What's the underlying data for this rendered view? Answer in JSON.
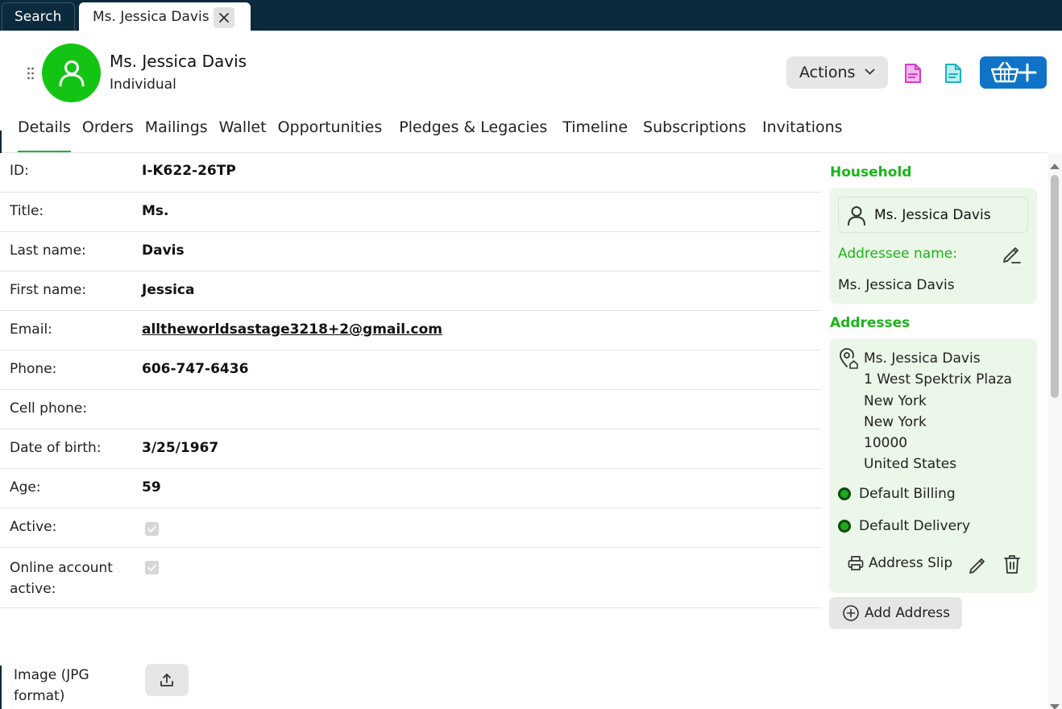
{
  "tabs": {
    "search_label": "Search",
    "active_label": "Ms. Jessica Davis"
  },
  "header": {
    "name": "Ms. Jessica Davis",
    "type": "Individual",
    "actions_label": "Actions"
  },
  "nav": {
    "items": [
      "Details",
      "Orders",
      "Mailings",
      "Wallet",
      "Opportunities",
      "Pledges & Legacies",
      "Timeline",
      "Subscriptions",
      "Invitations"
    ],
    "active": "Details"
  },
  "details": {
    "id_label": "ID:",
    "id_value": "I-K622-26TP",
    "title_label": "Title:",
    "title_value": "Ms.",
    "last_name_label": "Last name:",
    "last_name_value": "Davis",
    "first_name_label": "First name:",
    "first_name_value": "Jessica",
    "email_label": "Email:",
    "email_value": "alltheworldsastage3218+2@gmail.com",
    "phone_label": "Phone:",
    "phone_value": "606-747-6436",
    "cell_label": "Cell phone:",
    "cell_value": "",
    "dob_label": "Date of birth:",
    "dob_value": "3/25/1967",
    "age_label": "Age:",
    "age_value": "59",
    "active_label": "Active:",
    "active_checked": true,
    "online_label_1": "Online account",
    "online_label_2": "active:",
    "online_checked": true,
    "image_label_1": "Image (JPG",
    "image_label_2": "format)"
  },
  "household": {
    "title": "Household",
    "member_name": "Ms. Jessica Davis",
    "addressee_label": "Addressee name:",
    "addressee_value": "Ms. Jessica Davis"
  },
  "addresses": {
    "title": "Addresses",
    "lines": [
      "Ms. Jessica Davis",
      "1 West Spektrix Plaza",
      "New York",
      "New York",
      "10000",
      "United States"
    ],
    "default_billing": "Default Billing",
    "default_delivery": "Default Delivery",
    "slip_label": "Address Slip",
    "add_label": "Add Address"
  },
  "colors": {
    "topbar": "#0b2a3d",
    "accent_green": "#1ab51a",
    "avatar_green": "#14c414",
    "basket_blue": "#0f74c8",
    "doc_pink": "#d83ad0",
    "doc_teal": "#19b3c0"
  }
}
